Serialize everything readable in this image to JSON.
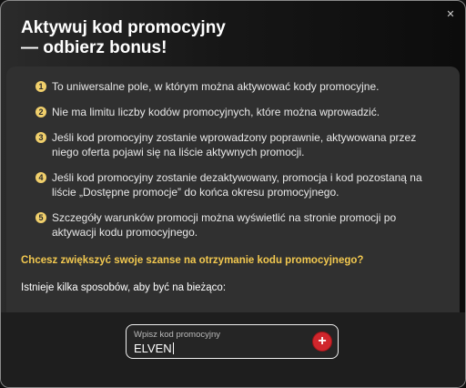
{
  "header": {
    "title_line1": "Aktywuj kod promocyjny",
    "title_line2": "— odbierz bonus!",
    "close_icon": "close-icon"
  },
  "rules": [
    {
      "num": "1",
      "text": "To uniwersalne pole, w którym można aktywować kody promocyjne."
    },
    {
      "num": "2",
      "text": "Nie ma limitu liczby kodów promocyjnych, które można wprowadzić."
    },
    {
      "num": "3",
      "text": "Jeśli kod promocyjny zostanie wprowadzony poprawnie, aktywowana przez niego oferta pojawi się na liście aktywnych promocji."
    },
    {
      "num": "4",
      "text": "Jeśli kod promocyjny zostanie dezaktywowany, promocja i kod pozostaną na liście „Dostępne promocje” do końca okresu promocyjnego."
    },
    {
      "num": "5",
      "text": "Szczegóły warunków promocji można wyświetlić na stronie promocji po aktywacji kodu promocyjnego."
    }
  ],
  "cta": "Chcesz zwiększyć swoje szanse na otrzymanie kodu promocyjnego?",
  "ways": "Istnieje kilka sposobów, aby być na bieżąco:",
  "promo_input": {
    "label": "Wpisz kod promocyjny",
    "value": "ELVEN",
    "submit_label": "+"
  },
  "colors": {
    "accent_yellow": "#f2c84f",
    "submit_red": "#d0262c"
  }
}
